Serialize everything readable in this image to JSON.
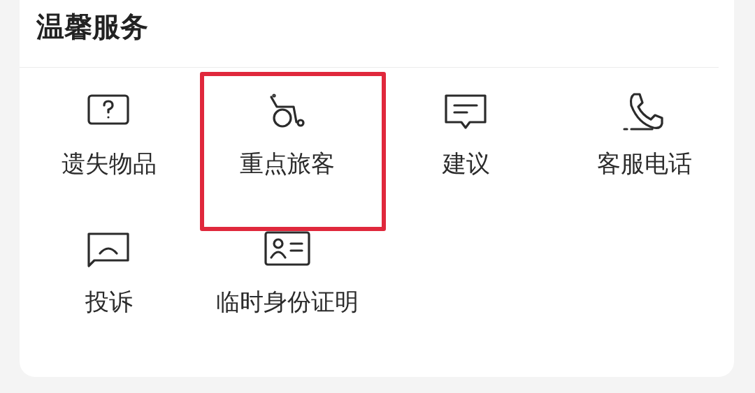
{
  "section": {
    "title": "温馨服务"
  },
  "services": [
    {
      "label": "遗失物品",
      "highlighted": false
    },
    {
      "label": "重点旅客",
      "highlighted": true
    },
    {
      "label": "建议",
      "highlighted": false
    },
    {
      "label": "客服电话",
      "highlighted": false
    },
    {
      "label": "投诉",
      "highlighted": false
    },
    {
      "label": "临时身份证明",
      "highlighted": false
    }
  ]
}
